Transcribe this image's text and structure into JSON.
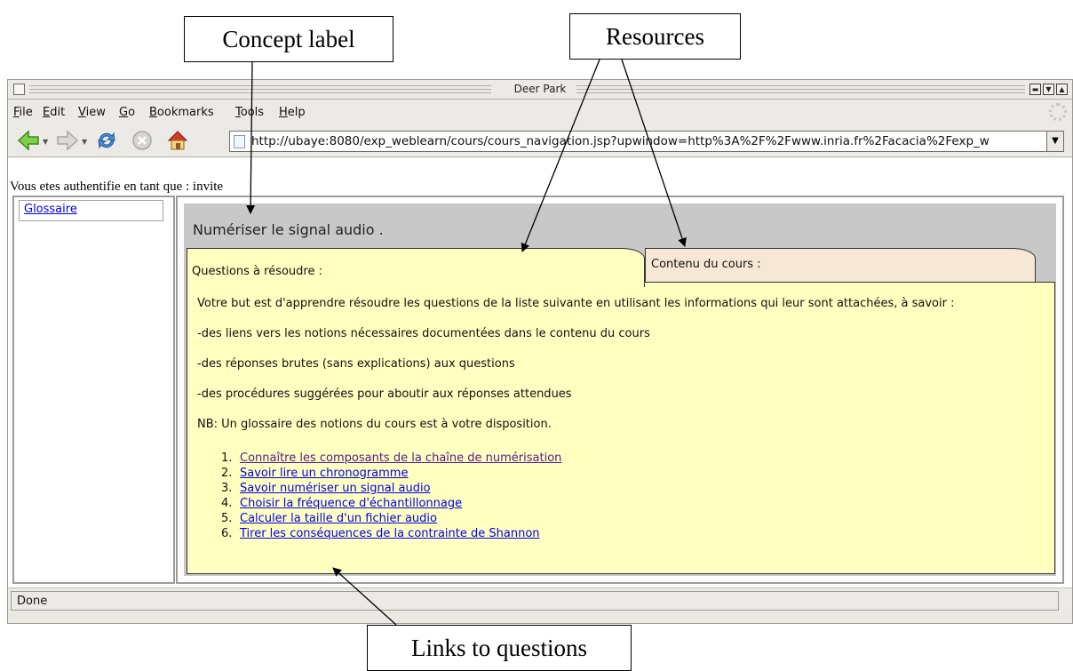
{
  "annotations": {
    "concept_label": "Concept label",
    "resources": "Resources",
    "links_to_questions": "Links to questions"
  },
  "window": {
    "title": "Deer Park"
  },
  "menu": [
    {
      "label": "File",
      "key": "F"
    },
    {
      "label": "Edit",
      "key": "E"
    },
    {
      "label": "View",
      "key": "V"
    },
    {
      "label": "Go",
      "key": "G"
    },
    {
      "label": "Bookmarks",
      "key": "B"
    },
    {
      "label": "Tools",
      "key": "T"
    },
    {
      "label": "Help",
      "key": "H"
    }
  ],
  "toolbar": {
    "icons": [
      "back-arrow-icon",
      "forward-arrow-icon",
      "reload-icon",
      "stop-icon",
      "home-icon"
    ],
    "url": "http://ubaye:8080/exp_weblearn/cours/cours_navigation.jsp?upwindow=http%3A%2F%2Fwww.inria.fr%2Facacia%2Fexp_w"
  },
  "page": {
    "auth_text": "Vous etes authentifie en tant que : invite",
    "sidebar_link": "Glossaire",
    "concept_title": "Numériser le signal audio .",
    "tabs": [
      {
        "label": "Questions à résoudre :",
        "color": "#ffffc0"
      },
      {
        "label": "Contenu du cours :",
        "color": "#f6e8d4"
      }
    ],
    "paragraphs": [
      "Votre but est d'apprendre résoudre les questions de la liste suivante en utilisant les informations qui leur sont attachées, à savoir :",
      "-des liens vers les notions nécessaires documentées dans le contenu du cours",
      "-des réponses brutes (sans explications) aux questions",
      "-des procédures suggérées pour aboutir aux réponses attendues",
      "NB: Un glossaire des notions du cours est à votre disposition."
    ],
    "questions": [
      {
        "num": "1.",
        "label": "Connaître les composants de la chaîne de numérisation"
      },
      {
        "num": "2.",
        "label": "Savoir lire un chronogramme"
      },
      {
        "num": "3.",
        "label": "Savoir numériser un signal audio"
      },
      {
        "num": "4.",
        "label": "Choisir la fréquence d'échantillonnage"
      },
      {
        "num": "5.",
        "label": "Calculer la taille d'un fichier audio"
      },
      {
        "num": "6.",
        "label": "Tirer les conséquences de la contrainte de Shannon"
      }
    ]
  },
  "status": {
    "text": "Done"
  },
  "colors": {
    "link": "#0000ee",
    "visited_link": "#551a8b",
    "questions_panel": "#ffffc0",
    "content_tab": "#f6e8d4",
    "header_bar": "#c8c8c8"
  }
}
